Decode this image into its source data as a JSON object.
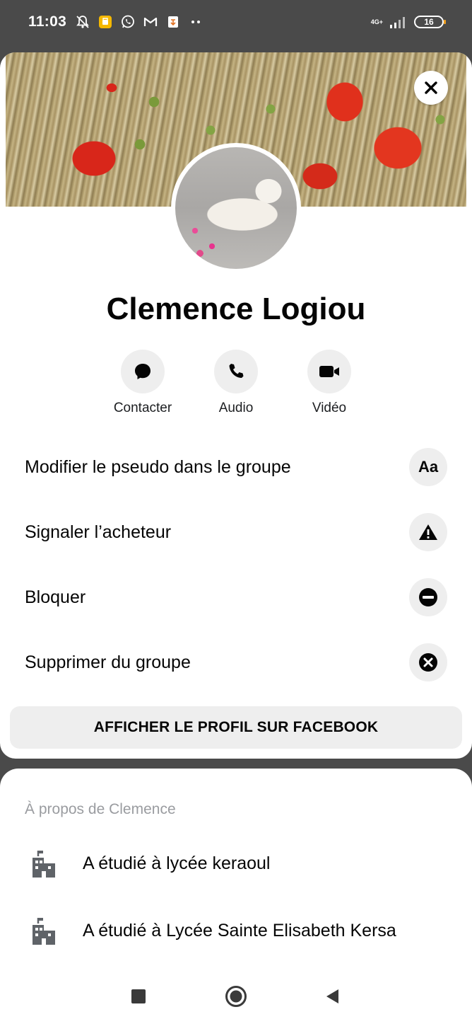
{
  "status_bar": {
    "time": "11:03",
    "network": "4G+",
    "battery": "16",
    "icons": [
      "notifications-off-icon",
      "app-notification-icon",
      "whatsapp-icon",
      "gmail-icon",
      "app-icon",
      "more-notifications-icon",
      "signal-icon"
    ]
  },
  "profile": {
    "name": "Clemence Logiou"
  },
  "actions": [
    {
      "label": "Contacter",
      "icon": "message-icon"
    },
    {
      "label": "Audio",
      "icon": "phone-icon"
    },
    {
      "label": "Vidéo",
      "icon": "video-icon"
    }
  ],
  "menu": [
    {
      "label": "Modifier le pseudo dans le groupe",
      "icon": "Aa"
    },
    {
      "label": "Signaler l’acheteur",
      "icon": "warning-icon"
    },
    {
      "label": "Bloquer",
      "icon": "block-icon"
    },
    {
      "label": "Supprimer du groupe",
      "icon": "remove-icon"
    }
  ],
  "facebook_button": "AFFICHER LE PROFIL SUR FACEBOOK",
  "about": {
    "title": "À propos de Clemence",
    "items": [
      {
        "text": "A étudié à lycée keraoul",
        "icon": "school-icon"
      },
      {
        "text": "A étudié à Lycée Sainte Elisabeth Kersa",
        "icon": "school-icon"
      }
    ]
  },
  "colors": {
    "card_bg": "#ffffff",
    "icon_bg": "#eeeeee",
    "scrim": "#4a4a4a",
    "muted_text": "#9a9ca0"
  }
}
